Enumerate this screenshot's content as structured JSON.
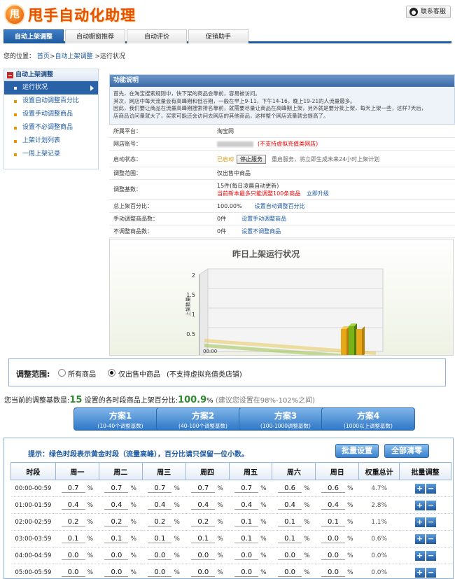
{
  "header": {
    "logo_char": "甩",
    "title": "甩手自动化助理",
    "service_label": "联系客服"
  },
  "nav": {
    "tabs": [
      "自动上架调整",
      "自动橱窗推荐",
      "自动评价",
      "促销助手"
    ]
  },
  "breadcrumb": {
    "prefix": "您的位置：",
    "home": "首页",
    "sep1": ">",
    "section": "自动上架调整",
    "current": ">运行状况"
  },
  "sidebar": {
    "title": "自动上架调整",
    "items": [
      "运行状况",
      "设置自动调整百分比",
      "设置手动调整商品",
      "设置不必调整商品",
      "上架计划列表",
      "一周上架记录"
    ]
  },
  "function_box": {
    "title": "功能说明",
    "lines": [
      "首先，在淘宝搜索规则中，快下架的商品会靠前，容易被访问。",
      "其次，网店中每天流量会有高峰期和低谷期，一般在早上9-11，下午14-16，晚上19-21的人流量最多。",
      "因此，我们要让商品在流量高峰期搜索排名靠前，就需要尽量让商品在高峰期上架，另外就是要分批上架，每天上架一些，这样7天后，",
      "店商品访问量就大了，买家可能还会访问去网店的其他商品，这样整个网店流量就会提高了。"
    ]
  },
  "info": {
    "platform": {
      "label": "所属平台：",
      "value": "淘宝网"
    },
    "account": {
      "label": "网店账号：",
      "note": "(不支持虚拟充值类网店)"
    },
    "status": {
      "label": "启动状态：",
      "value": "已启动",
      "button": "停止服务",
      "hint": "重启服务，将立即生成未来24小时上架计划"
    },
    "scope": {
      "label": "调整范围：",
      "value": "仅出售中商品"
    },
    "base": {
      "label": "调整基数：",
      "value": "15件(每日凌晨自动更新)",
      "warn": "当前新本最多只能调整100条商品",
      "link": "立即升级"
    },
    "total_pct": {
      "label": "总上架百分比：",
      "value": "100.00%",
      "link": "设置自动调整百分比"
    },
    "manual": {
      "label": "手动调整商品数：",
      "value": "0件",
      "link": "设置手动调整商品"
    },
    "noadjust": {
      "label": "不调整商品数：",
      "value": "0件",
      "link": "设置不调整商品"
    }
  },
  "chart_data": {
    "type": "bar",
    "title": "昨日上架运行状况",
    "ylabel": "上架数量",
    "yticks": [
      "2",
      "1.5",
      "1",
      "0.5"
    ],
    "x_first_label": "00:00",
    "colors": {
      "plan": "#e6a817",
      "actual": "#7ab317",
      "base": "#e0cfa0"
    }
  },
  "scope_select": {
    "label": "调整范围:",
    "options": [
      "所有商品",
      "仅出售中商品"
    ],
    "selected": 1,
    "note": "(不支持虚拟充值类店铺)"
  },
  "base_line": {
    "prefix": "您当前的调整基数是:",
    "count": "15",
    "middle": " 设置的各时段商品上架百分比:",
    "percent": "100.9",
    "pct_sign": "%",
    "hint": " (建议您设置在98%-102%之间)"
  },
  "plans": [
    {
      "title": "方案1",
      "sub": "(10-40个调整基数)"
    },
    {
      "title": "方案2",
      "sub": "(40-100个调整基数)"
    },
    {
      "title": "方案3",
      "sub": "(100-1000调整基数)"
    },
    {
      "title": "方案4",
      "sub": "(1000以上调整基数)"
    }
  ],
  "table": {
    "tip": "提示：绿色时段表示黄金时段（流量高峰），百分比请只保留一位小数。",
    "batch_btn": "批量设置",
    "clear_btn": "全部清零",
    "headers": [
      "时段",
      "周一",
      "周二",
      "周三",
      "周四",
      "周五",
      "周六",
      "周日",
      "权重总计",
      "批量调整"
    ],
    "unit": "%",
    "rows": [
      {
        "time": "00:00-00:59",
        "vals": [
          "0.7",
          "0.7",
          "0.7",
          "0.7",
          "0.7",
          "0.6",
          "0.6"
        ],
        "total": "4.7%"
      },
      {
        "time": "01:00-01:59",
        "vals": [
          "0.4",
          "0.4",
          "0.4",
          "0.4",
          "0.4",
          "0.4",
          "0.4"
        ],
        "total": "2.8%"
      },
      {
        "time": "02:00-02:59",
        "vals": [
          "0.2",
          "0.2",
          "0.2",
          "0.2",
          "0.1",
          "0.1",
          "0.1"
        ],
        "total": "1.1%"
      },
      {
        "time": "03:00-03:59",
        "vals": [
          "0.1",
          "0.1",
          "0.1",
          "0.1",
          "0.1",
          "0.1",
          "0.0"
        ],
        "total": "0.6%"
      },
      {
        "time": "04:00-04:59",
        "vals": [
          "0.0",
          "0.0",
          "0.0",
          "0.0",
          "0.0",
          "0.0",
          "0.0"
        ],
        "total": "0.0%"
      },
      {
        "time": "05:00-05:59",
        "vals": [
          "0.0",
          "0.0",
          "0.0",
          "0.0",
          "0.0",
          "0.0",
          "0.0"
        ],
        "total": "0.0%"
      }
    ]
  }
}
